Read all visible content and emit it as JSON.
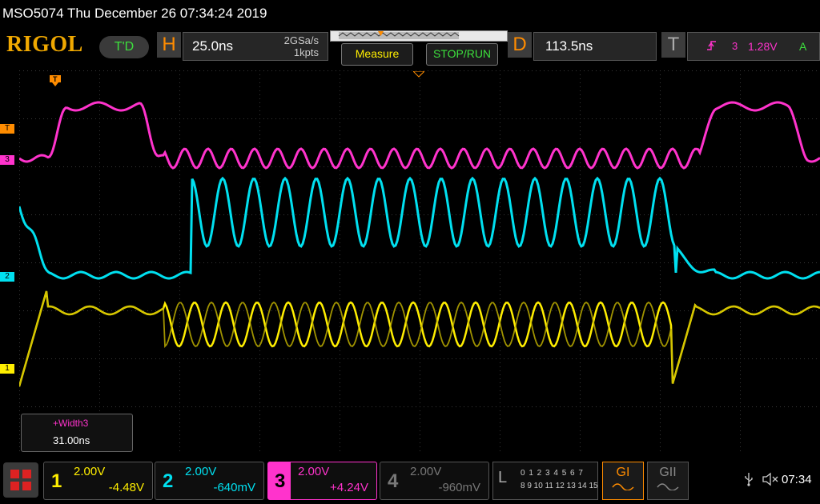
{
  "title_bar": {
    "text": "MSO5074  Thu December 26 07:34:24 2019"
  },
  "logo": "RIGOL",
  "status_badge": "T'D",
  "horizontal": {
    "letter": "H",
    "timebase": "25.0ns",
    "sample_rate": "2GSa/s",
    "memory_depth": "1kpts"
  },
  "buttons": {
    "measure": "Measure",
    "stop_run": "STOP/RUN"
  },
  "delay": {
    "letter": "D",
    "value": "113.5ns"
  },
  "trigger": {
    "letter": "T",
    "slope_icon": "rising-edge-icon",
    "source": "3",
    "level": "1.28V",
    "mode": "A"
  },
  "markers": {
    "trigger_top": "T",
    "trigger_level": "T",
    "ch3": "3",
    "ch2": "2",
    "ch1": "1"
  },
  "measurement": {
    "label": "+Width3",
    "value": "31.00ns"
  },
  "channels": [
    {
      "num": "1",
      "scale": "2.00V",
      "offset": "-4.48V",
      "color": "#ffee00"
    },
    {
      "num": "2",
      "scale": "2.00V",
      "offset": "-640mV",
      "color": "#00e0f0"
    },
    {
      "num": "3",
      "scale": "2.00V",
      "offset": "+4.24V",
      "color": "#ff33cc"
    },
    {
      "num": "4",
      "scale": "2.00V",
      "offset": "-960mV",
      "color": "#777777"
    }
  ],
  "logic": {
    "letter": "L",
    "bits_row1": "0 1 2 3   4 5 6 7",
    "bits_row2": "8 9 10 11  12 13 14 15"
  },
  "decoders": {
    "g1": "GI",
    "g2": "GII"
  },
  "clock": "07:34",
  "colors": {
    "accent": "#ff8c00",
    "ch1": "#ffee00",
    "ch2": "#00e0f0",
    "ch3": "#ff33cc"
  }
}
